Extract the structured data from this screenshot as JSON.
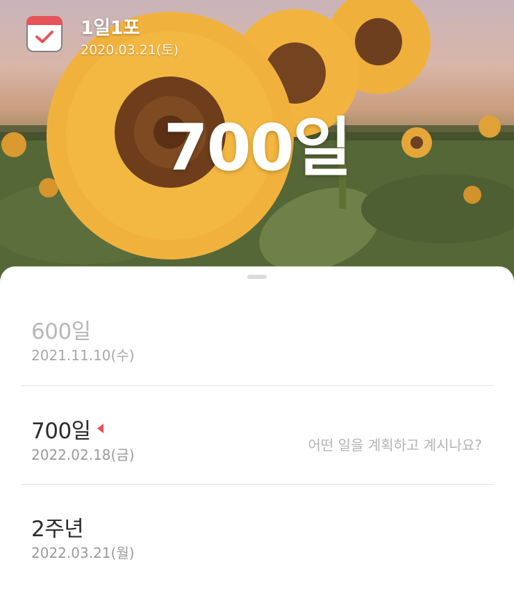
{
  "header": {
    "app_title": "1일1포",
    "start_date": "2020.03.21(토)",
    "icon": "calendar-check-icon",
    "big_count": "700일"
  },
  "list": {
    "items": [
      {
        "title": "600일",
        "date": "2021.11.10(수)",
        "state": "past"
      },
      {
        "title": "700일",
        "date": "2022.02.18(금)",
        "state": "current",
        "prompt": "어떤 일을 계획하고 계시나요?"
      },
      {
        "title": "2주년",
        "date": "2022.03.21(월)",
        "state": "upcoming"
      }
    ]
  },
  "colors": {
    "accent": "#e6535b",
    "past_text": "#b8b8b8",
    "date_text": "#9a9a9a"
  }
}
